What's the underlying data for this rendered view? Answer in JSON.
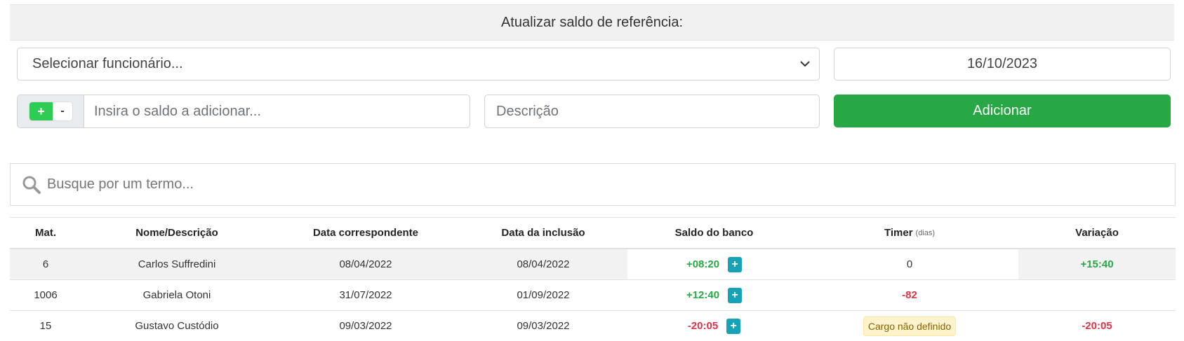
{
  "reference": {
    "title": "Atualizar saldo de referência:",
    "employee_select": "Selecionar funcionário...",
    "date": "16/10/2023",
    "sign_plus": "+",
    "sign_minus": "-",
    "saldo_placeholder": "Insira o saldo a adicionar...",
    "description_placeholder": "Descrição",
    "add_label": "Adicionar"
  },
  "search": {
    "placeholder": "Busque por um termo..."
  },
  "table": {
    "headers": {
      "mat": "Mat.",
      "nome": "Nome/Descrição",
      "data_corr": "Data correspondente",
      "data_incl": "Data da inclusão",
      "saldo": "Saldo do banco",
      "timer": "Timer",
      "timer_sub": "(dias)",
      "variacao": "Variação"
    },
    "plus_label": "+",
    "rows": [
      {
        "mat": "6",
        "nome": "Carlos Suffredini",
        "data_corr": "08/04/2022",
        "data_incl": "08/04/2022",
        "saldo": "+08:20",
        "timer": "0",
        "variacao": "+15:40"
      },
      {
        "mat": "1006",
        "nome": "Gabriela Otoni",
        "data_corr": "31/07/2022",
        "data_incl": "01/09/2022",
        "saldo": "+12:40",
        "timer": "-82",
        "variacao": ""
      },
      {
        "mat": "15",
        "nome": "Gustavo Custódio",
        "data_corr": "09/03/2022",
        "data_incl": "09/03/2022",
        "saldo": "-20:05",
        "timer": "Cargo não definido",
        "variacao": "-20:05"
      }
    ]
  },
  "colors": {
    "positive": "#28a745",
    "negative": "#dc3545",
    "accent": "#17a2b8",
    "primary_green": "#28a745"
  }
}
